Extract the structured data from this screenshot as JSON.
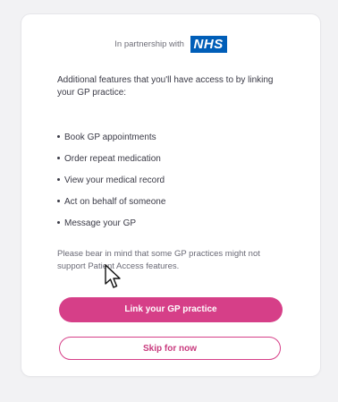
{
  "partnership": {
    "text": "In partnership with",
    "logo_text": "NHS",
    "logo_color": "#005eb8"
  },
  "intro": "Additional features that you'll have access to by linking your GP practice:",
  "features": [
    "Book GP appointments",
    "Order repeat medication",
    "View your medical record",
    "Act on behalf of someone",
    "Message your GP"
  ],
  "note": "Please bear in mind that some GP practices might not support Patient Access features.",
  "buttons": {
    "primary_label": "Link your GP practice",
    "secondary_label": "Skip for now",
    "accent_color": "#d63f88"
  },
  "cursor": {
    "icon": "mouse-pointer-icon"
  }
}
